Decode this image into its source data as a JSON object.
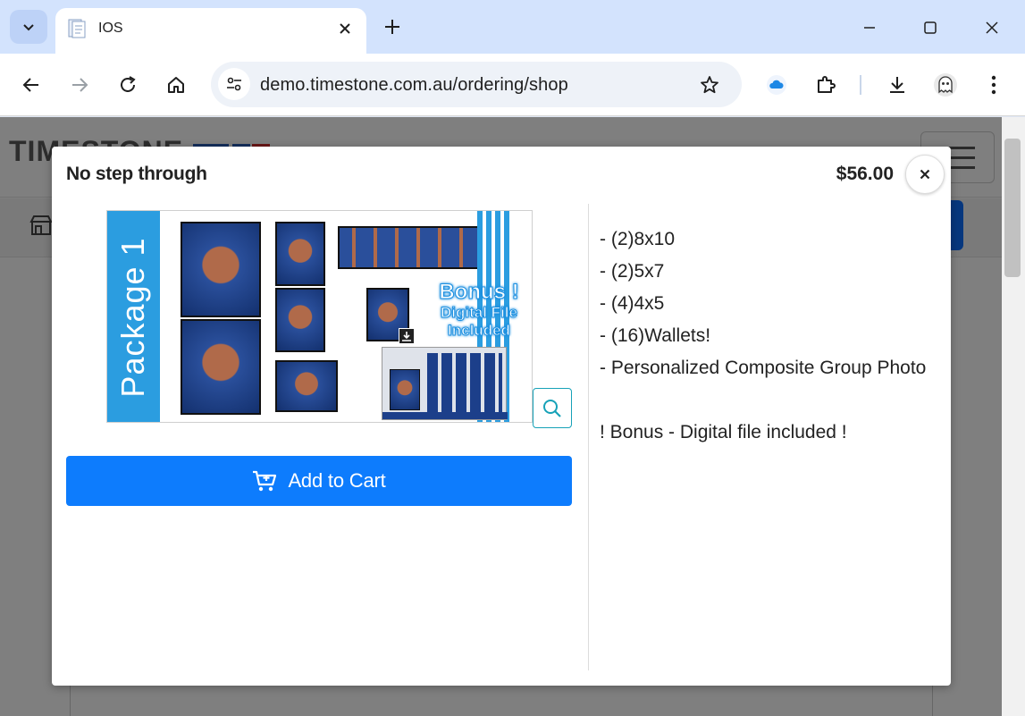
{
  "browser": {
    "tab_title": "IOS",
    "url": "demo.timestone.com.au/ordering/shop"
  },
  "site": {
    "logo_text": "TIMESTONE"
  },
  "modal": {
    "title": "No step through",
    "price": "$56.00",
    "close_label": "×",
    "image": {
      "package_label": "Package 1",
      "bonus_line1": "Bonus !",
      "bonus_line2": "Digital File",
      "bonus_line3": "Included"
    },
    "add_to_cart_label": "Add to Cart",
    "description": [
      "- (2)8x10",
      "- (2)5x7",
      "- (4)4x5",
      "- (16)Wallets!",
      "- Personalized Composite Group Photo",
      "",
      "! Bonus - Digital file included !"
    ]
  },
  "colors": {
    "primary_button": "#0d7cfd",
    "package_band": "#2b9de0",
    "zoom_border": "#17a2b8"
  }
}
